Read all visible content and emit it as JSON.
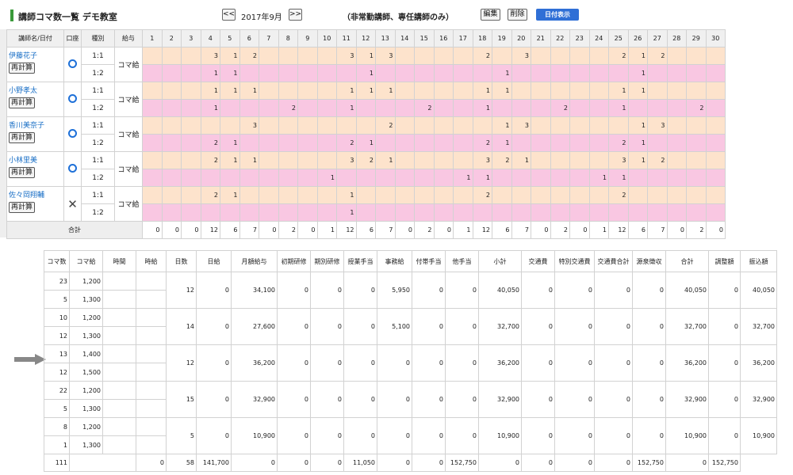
{
  "header": {
    "title": "講師コマ数一覧  デモ教室",
    "prev_label": "<<",
    "month": "2017年9月",
    "next_label": ">>",
    "note": "（非常勤講師、専任講師のみ）",
    "edit_label": "編集",
    "delete_label": "削除",
    "date_display_label": "日付表示"
  },
  "colors": {
    "accent_green": "#3a9a3a",
    "date_button": "#2f6fd6",
    "row_1to1": "#fde3cc",
    "row_1to2": "#f9c7e2",
    "account_ok": "#1e70d8"
  },
  "grid": {
    "head": {
      "name": "講師名/日付",
      "account": "口座",
      "type": "種別",
      "pay": "給与"
    },
    "days": [
      "1",
      "2",
      "3",
      "4",
      "5",
      "6",
      "7",
      "8",
      "9",
      "10",
      "11",
      "12",
      "13",
      "14",
      "15",
      "16",
      "17",
      "18",
      "19",
      "20",
      "21",
      "22",
      "23",
      "24",
      "25",
      "26",
      "27",
      "28",
      "29",
      "30"
    ],
    "teachers": [
      {
        "name": "伊藤花子",
        "recalc": "再計算",
        "account_icon": "circle-icon",
        "pay": "コマ給",
        "rows": [
          {
            "type": "1:1",
            "cells": [
              "",
              "",
              "",
              "3",
              "1",
              "2",
              "",
              "",
              "",
              "",
              "3",
              "1",
              "3",
              "",
              "",
              "",
              "",
              "2",
              "",
              "3",
              "",
              "",
              "",
              "",
              "2",
              "1",
              "2",
              "",
              "",
              ""
            ]
          },
          {
            "type": "1:2",
            "cells": [
              "",
              "",
              "",
              "1",
              "1",
              "",
              "",
              "",
              "",
              "",
              "",
              "1",
              "",
              "",
              "",
              "",
              "",
              "",
              "1",
              "",
              "",
              "",
              "",
              "",
              "",
              "1",
              "",
              "",
              "",
              ""
            ]
          }
        ]
      },
      {
        "name": "小野孝太",
        "recalc": "再計算",
        "account_icon": "circle-icon",
        "pay": "コマ給",
        "rows": [
          {
            "type": "1:1",
            "cells": [
              "",
              "",
              "",
              "1",
              "1",
              "1",
              "",
              "",
              "",
              "",
              "1",
              "1",
              "1",
              "",
              "",
              "",
              "",
              "1",
              "1",
              "",
              "",
              "",
              "",
              "",
              "1",
              "1",
              "",
              "",
              "",
              ""
            ]
          },
          {
            "type": "1:2",
            "cells": [
              "",
              "",
              "",
              "1",
              "",
              "",
              "",
              "2",
              "",
              "",
              "1",
              "",
              "",
              "",
              "2",
              "",
              "",
              "1",
              "",
              "",
              "",
              "2",
              "",
              "",
              "1",
              "",
              "",
              "",
              "2",
              ""
            ]
          }
        ]
      },
      {
        "name": "香川美奈子",
        "recalc": "再計算",
        "account_icon": "circle-icon",
        "pay": "コマ給",
        "rows": [
          {
            "type": "1:1",
            "cells": [
              "",
              "",
              "",
              "",
              "",
              "3",
              "",
              "",
              "",
              "",
              "",
              "",
              "2",
              "",
              "",
              "",
              "",
              "",
              "1",
              "3",
              "",
              "",
              "",
              "",
              "",
              "1",
              "3",
              "",
              "",
              ""
            ]
          },
          {
            "type": "1:2",
            "cells": [
              "",
              "",
              "",
              "2",
              "1",
              "",
              "",
              "",
              "",
              "",
              "2",
              "1",
              "",
              "",
              "",
              "",
              "",
              "2",
              "1",
              "",
              "",
              "",
              "",
              "",
              "2",
              "1",
              "",
              "",
              "",
              ""
            ]
          }
        ]
      },
      {
        "name": "小林里美",
        "recalc": "再計算",
        "account_icon": "circle-icon",
        "pay": "コマ給",
        "rows": [
          {
            "type": "1:1",
            "cells": [
              "",
              "",
              "",
              "2",
              "1",
              "1",
              "",
              "",
              "",
              "",
              "3",
              "2",
              "1",
              "",
              "",
              "",
              "",
              "3",
              "2",
              "1",
              "",
              "",
              "",
              "",
              "3",
              "1",
              "2",
              "",
              "",
              ""
            ]
          },
          {
            "type": "1:2",
            "cells": [
              "",
              "",
              "",
              "",
              "",
              "",
              "",
              "",
              "",
              "1",
              "",
              "",
              "",
              "",
              "",
              "",
              "1",
              "1",
              "",
              "",
              "",
              "",
              "",
              "1",
              "1",
              "",
              "",
              "",
              "",
              ""
            ]
          }
        ]
      },
      {
        "name": "佐々岡翔輔",
        "recalc": "再計算",
        "account_icon": "cross-icon",
        "pay": "コマ給",
        "rows": [
          {
            "type": "1:1",
            "cells": [
              "",
              "",
              "",
              "2",
              "1",
              "",
              "",
              "",
              "",
              "",
              "1",
              "",
              "",
              "",
              "",
              "",
              "",
              "2",
              "",
              "",
              "",
              "",
              "",
              "",
              "2",
              "",
              "",
              "",
              "",
              ""
            ]
          },
          {
            "type": "1:2",
            "cells": [
              "",
              "",
              "",
              "",
              "",
              "",
              "",
              "",
              "",
              "",
              "1",
              "",
              "",
              "",
              "",
              "",
              "",
              "",
              "",
              "",
              "",
              "",
              "",
              "",
              "",
              "",
              "",
              "",
              "",
              ""
            ]
          }
        ]
      }
    ],
    "total_label": "合計",
    "totals": [
      "0",
      "0",
      "0",
      "12",
      "6",
      "7",
      "0",
      "2",
      "0",
      "1",
      "12",
      "6",
      "7",
      "0",
      "2",
      "0",
      "1",
      "12",
      "6",
      "7",
      "0",
      "2",
      "0",
      "1",
      "12",
      "6",
      "7",
      "0",
      "2",
      "0"
    ]
  },
  "summary": {
    "headers": [
      "コマ数",
      "コマ給",
      "時間",
      "時給",
      "日数",
      "日給",
      "月額給与",
      "初期研修",
      "期別研修",
      "授業手当",
      "事務給",
      "付帯手当",
      "他手当",
      "小計",
      "交通費",
      "特別交通費",
      "交通費合計",
      "源泉徴収",
      "合計",
      "調整額",
      "振込額"
    ],
    "teachers": [
      {
        "lines": [
          {
            "koma": "23",
            "rate": "1,200"
          },
          {
            "koma": "5",
            "rate": "1,300"
          }
        ],
        "vals": [
          "12",
          "0",
          "34,100",
          "0",
          "0",
          "0",
          "5,950",
          "0",
          "0",
          "40,050",
          "0",
          "0",
          "0",
          "0",
          "40,050",
          "0",
          "40,050"
        ]
      },
      {
        "lines": [
          {
            "koma": "10",
            "rate": "1,200"
          },
          {
            "koma": "12",
            "rate": "1,300"
          }
        ],
        "vals": [
          "14",
          "0",
          "27,600",
          "0",
          "0",
          "0",
          "5,100",
          "0",
          "0",
          "32,700",
          "0",
          "0",
          "0",
          "0",
          "32,700",
          "0",
          "32,700"
        ]
      },
      {
        "lines": [
          {
            "koma": "13",
            "rate": "1,400"
          },
          {
            "koma": "12",
            "rate": "1,500"
          }
        ],
        "vals": [
          "12",
          "0",
          "36,200",
          "0",
          "0",
          "0",
          "0",
          "0",
          "0",
          "36,200",
          "0",
          "0",
          "0",
          "0",
          "36,200",
          "0",
          "36,200"
        ]
      },
      {
        "lines": [
          {
            "koma": "22",
            "rate": "1,200"
          },
          {
            "koma": "5",
            "rate": "1,300"
          }
        ],
        "vals": [
          "15",
          "0",
          "32,900",
          "0",
          "0",
          "0",
          "0",
          "0",
          "0",
          "32,900",
          "0",
          "0",
          "0",
          "0",
          "32,900",
          "0",
          "32,900"
        ]
      },
      {
        "lines": [
          {
            "koma": "8",
            "rate": "1,200"
          },
          {
            "koma": "1",
            "rate": "1,300"
          }
        ],
        "vals": [
          "5",
          "0",
          "10,900",
          "0",
          "0",
          "0",
          "0",
          "0",
          "0",
          "10,900",
          "0",
          "0",
          "0",
          "0",
          "10,900",
          "0",
          "10,900"
        ]
      }
    ],
    "totals": [
      "111",
      "",
      "",
      "0",
      "58",
      "141,700",
      "0",
      "0",
      "0",
      "11,050",
      "0",
      "0",
      "152,750",
      "0",
      "0",
      "0",
      "0",
      "152,750",
      "0",
      "152,750"
    ]
  }
}
